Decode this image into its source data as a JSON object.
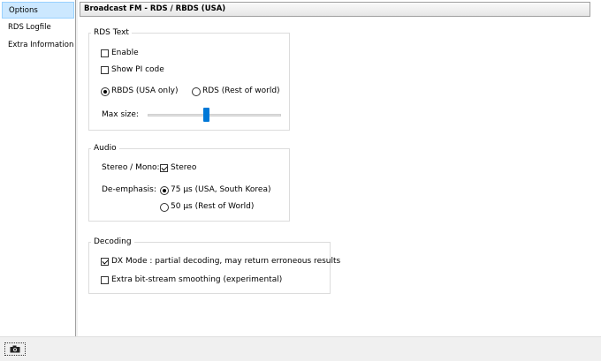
{
  "sidebar": {
    "items": [
      {
        "label": "Options",
        "selected": true
      },
      {
        "label": "RDS Logfile",
        "selected": false
      },
      {
        "label": "Extra Information",
        "selected": false
      }
    ]
  },
  "header": {
    "title": "Broadcast FM - RDS / RBDS (USA)"
  },
  "rds_text": {
    "title": "RDS Text",
    "enable_label": "Enable",
    "enable_checked": false,
    "show_pi_label": "Show PI code",
    "show_pi_checked": false,
    "rbds_label": "RBDS (USA only)",
    "rds_label": "RDS (Rest of world)",
    "selected_mode": "RBDS (USA only)",
    "max_size_label": "Max size:",
    "max_size_level": 0.44
  },
  "audio": {
    "title": "Audio",
    "stereo_mono_label": "Stereo / Mono:",
    "stereo_label": "Stereo",
    "stereo_checked": true,
    "deemphasis_label": "De-emphasis:",
    "option_75": "75 µs (USA, South Korea)",
    "option_50": "50 µs (Rest of World)",
    "selected_deemphasis": "75 µs (USA, South Korea)"
  },
  "decoding": {
    "title": "Decoding",
    "dx_label": "DX Mode : partial decoding, may return erroneous results",
    "dx_checked": true,
    "smoothing_label": "Extra bit-stream smoothing (experimental)",
    "smoothing_checked": false
  },
  "bottom": {
    "camera_icon": "camera-icon"
  },
  "colors": {
    "selection": "#cce8ff",
    "slider_thumb": "#0078d7"
  }
}
